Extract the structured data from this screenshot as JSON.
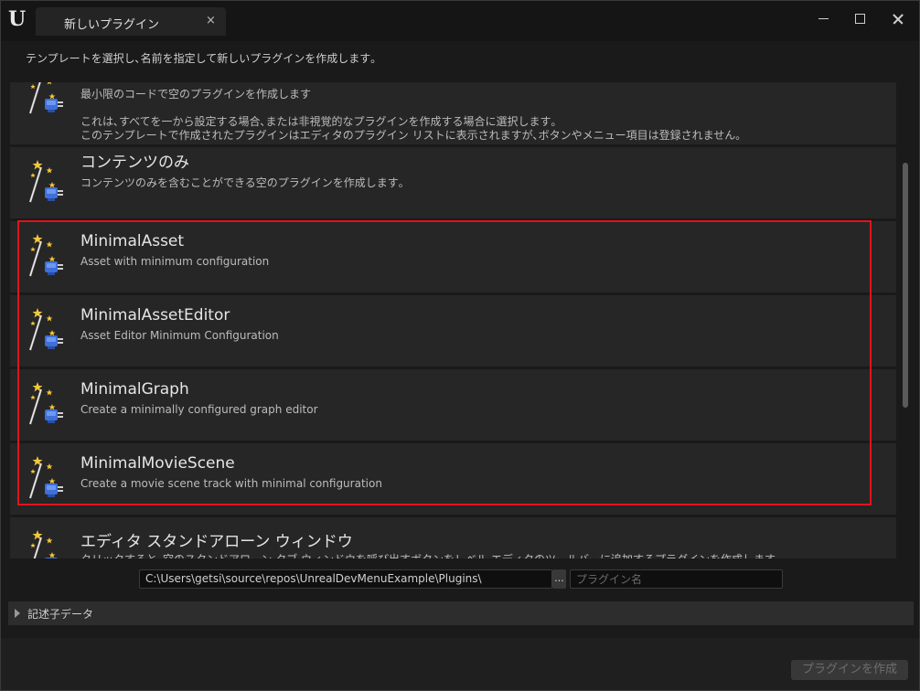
{
  "window": {
    "tab_title": "新しいプラグイン",
    "tab_close": "×",
    "description": "テンプレートを選択し､名前を指定して新しいプラグインを作成します｡"
  },
  "templates": [
    {
      "title": "",
      "description": "最小限のコードで空のプラグインを作成します",
      "detail1": "これは､すべてを一から設定する場合､または非視覚的なプラグインを作成する場合に選択します｡",
      "detail2": "このテンプレートで作成されたプラグインはエディタのプラグイン リストに表示されますが､ボタンやメニュー項目は登録されません｡"
    },
    {
      "title": "コンテンツのみ",
      "description": "コンテンツのみを含むことができる空のプラグインを作成します｡"
    },
    {
      "title": "MinimalAsset",
      "description": "Asset with minimum configuration"
    },
    {
      "title": "MinimalAssetEditor",
      "description": "Asset Editor Minimum Configuration"
    },
    {
      "title": "MinimalGraph",
      "description": "Create a minimally configured graph editor"
    },
    {
      "title": "MinimalMovieScene",
      "description": "Create a movie scene track with minimal configuration"
    },
    {
      "title": "エディタ スタンドアローン ウィンドウ",
      "description": "クリックすると､空のスタンドアローン タブ ウィンドウを呼び出すボタンをレベル エディタのツールバーに追加するプラグインを作成します｡"
    }
  ],
  "form": {
    "path_value": "C:\\Users\\getsi\\source\\repos\\UnrealDevMenuExample\\Plugins\\",
    "browse_label": "...",
    "name_placeholder": "プラグイン名"
  },
  "details_label": "記述子データ",
  "create_button": "プラグインを作成",
  "colors": {
    "highlight": "#e0141b",
    "background": "#1a1a1a",
    "item": "#262626"
  }
}
